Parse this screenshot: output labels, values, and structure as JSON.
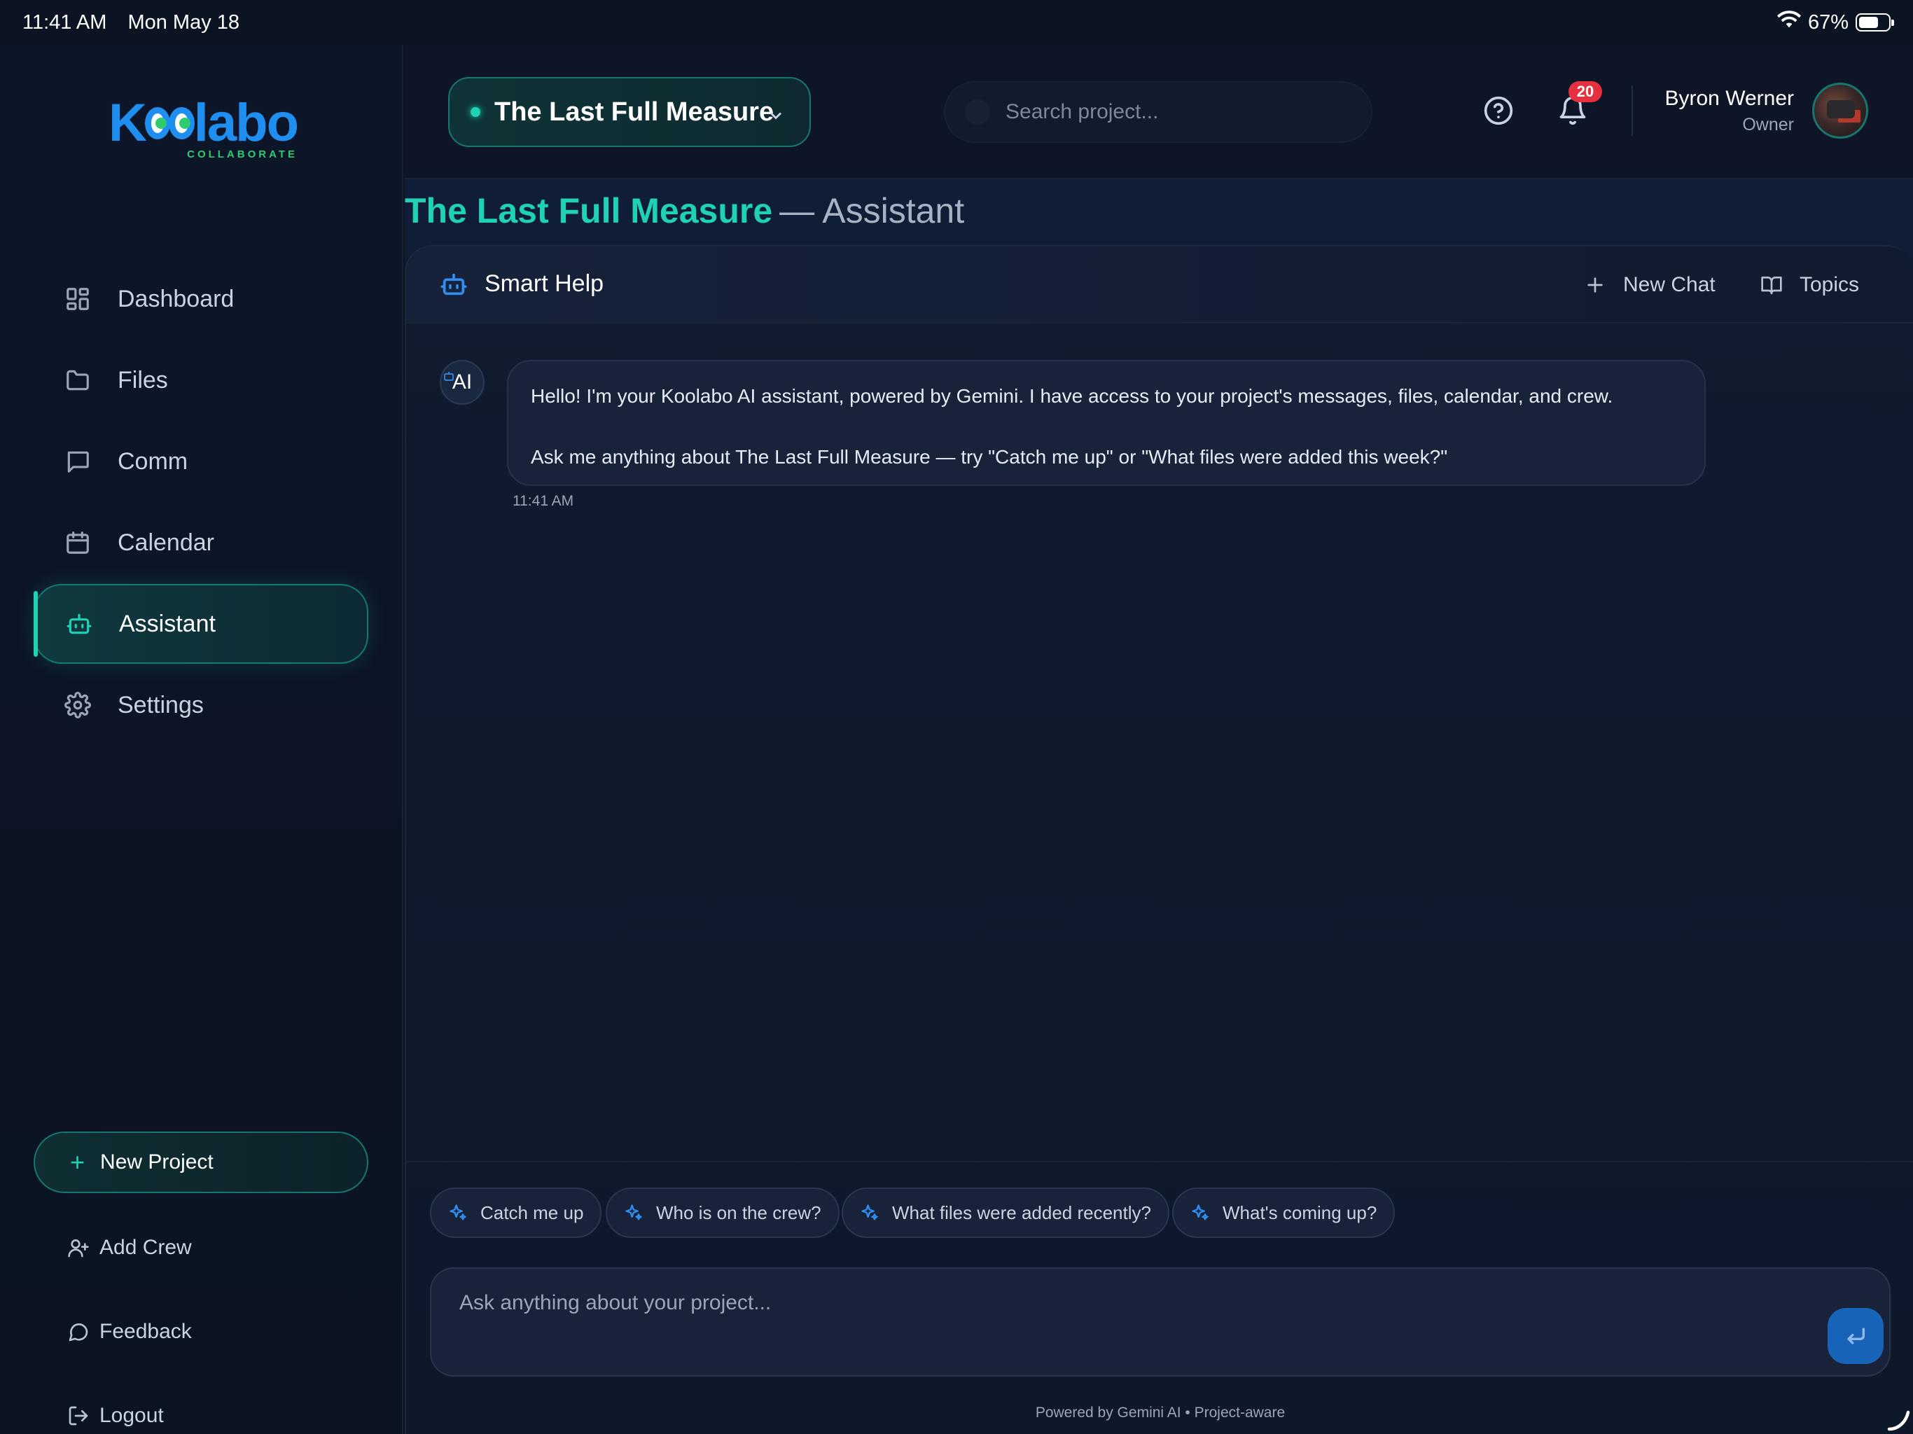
{
  "status_bar": {
    "time": "11:41 AM",
    "date": "Mon May 18",
    "battery": "67%",
    "battery_level": 0.67,
    "wifi_icon": "wifi-icon",
    "battery_icon": "battery-icon"
  },
  "logo": {
    "wordmark_prefix": "K",
    "wordmark_suffix": "labo",
    "tagline": "COLLABORATE"
  },
  "sidebar": {
    "items": [
      {
        "label": "Dashboard",
        "icon": "dashboard-icon"
      },
      {
        "label": "Files",
        "icon": "folder-icon"
      },
      {
        "label": "Comm",
        "icon": "message-icon"
      },
      {
        "label": "Calendar",
        "icon": "calendar-icon"
      },
      {
        "label": "Assistant",
        "icon": "robot-icon",
        "active": true
      },
      {
        "label": "Settings",
        "icon": "gear-icon"
      }
    ],
    "new_project": "New Project",
    "add_crew": "Add Crew",
    "feedback": "Feedback",
    "logout": "Logout"
  },
  "header": {
    "project_name": "The Last Full Measure",
    "search_placeholder": "Search project...",
    "notification_count": "20",
    "user_name": "Byron Werner",
    "user_role": "Owner"
  },
  "page": {
    "title_project": "The Last Full Measure",
    "title_suffix": "— Assistant"
  },
  "panel": {
    "title": "Smart Help",
    "new_chat": "New Chat",
    "topics": "Topics"
  },
  "messages": [
    {
      "sender": "AI",
      "lines": [
        "Hello! I'm your Koolabo AI assistant, powered by Gemini. I have access to your project's messages, files, calendar, and crew.",
        "Ask me anything about The Last Full Measure — try \"Catch me up\" or \"What files were added this week?\""
      ],
      "time": "11:41 AM"
    }
  ],
  "suggestions": [
    "Catch me up",
    "Who is on the crew?",
    "What files were added recently?",
    "What's coming up?"
  ],
  "composer": {
    "placeholder": "Ask anything about your project...",
    "footer": "Powered by Gemini AI • Project-aware"
  },
  "colors": {
    "accent_teal": "#1fd1b5",
    "accent_blue": "#1f8ef1",
    "badge_red": "#e5303f",
    "background": "#0c1424"
  }
}
